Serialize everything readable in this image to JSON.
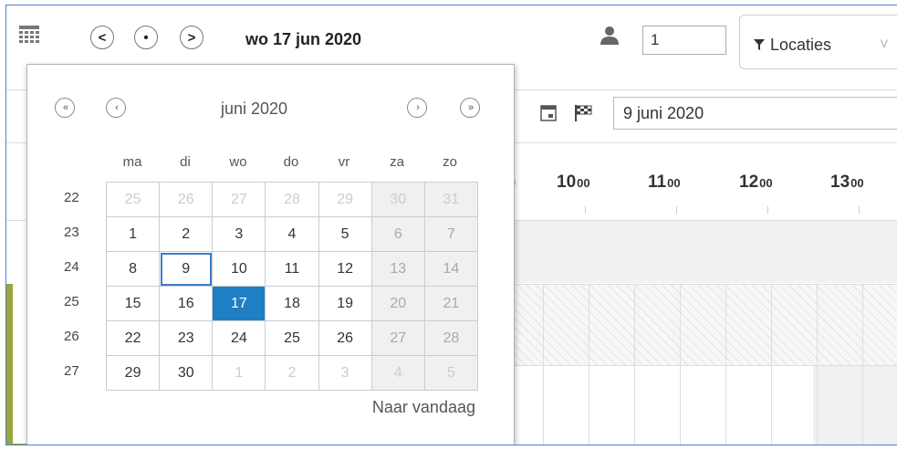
{
  "toolbar": {
    "prev_label": "<",
    "today_label": "•",
    "next_label": ">",
    "current_date": "wo 17 jun 2020",
    "persons_value": "1",
    "locations_label": "Locaties",
    "locations_chevron": "v"
  },
  "filters": {
    "end_date": "9 juni 2020"
  },
  "timeline": {
    "hours": [
      {
        "h": "10",
        "m": "00"
      },
      {
        "h": "11",
        "m": "00"
      },
      {
        "h": "12",
        "m": "00"
      },
      {
        "h": "13",
        "m": "00"
      }
    ],
    "partial_hour": ")"
  },
  "calendar": {
    "month_label": "juni 2020",
    "prev_year": "«",
    "prev_month": "‹",
    "next_month": "›",
    "next_year": "»",
    "weekdays": [
      "ma",
      "di",
      "wo",
      "do",
      "vr",
      "za",
      "zo"
    ],
    "weeks": [
      {
        "week": "22",
        "days": [
          {
            "d": "25",
            "other": true
          },
          {
            "d": "26",
            "other": true
          },
          {
            "d": "27",
            "other": true
          },
          {
            "d": "28",
            "other": true
          },
          {
            "d": "29",
            "other": true
          },
          {
            "d": "30",
            "other": true
          },
          {
            "d": "31",
            "other": true
          }
        ]
      },
      {
        "week": "23",
        "days": [
          {
            "d": "1"
          },
          {
            "d": "2"
          },
          {
            "d": "3"
          },
          {
            "d": "4"
          },
          {
            "d": "5"
          },
          {
            "d": "6"
          },
          {
            "d": "7"
          }
        ]
      },
      {
        "week": "24",
        "days": [
          {
            "d": "8"
          },
          {
            "d": "9",
            "chosen": true
          },
          {
            "d": "10"
          },
          {
            "d": "11"
          },
          {
            "d": "12"
          },
          {
            "d": "13"
          },
          {
            "d": "14"
          }
        ]
      },
      {
        "week": "25",
        "days": [
          {
            "d": "15"
          },
          {
            "d": "16"
          },
          {
            "d": "17",
            "selected": true
          },
          {
            "d": "18"
          },
          {
            "d": "19"
          },
          {
            "d": "20"
          },
          {
            "d": "21"
          }
        ]
      },
      {
        "week": "26",
        "days": [
          {
            "d": "22"
          },
          {
            "d": "23"
          },
          {
            "d": "24"
          },
          {
            "d": "25"
          },
          {
            "d": "26"
          },
          {
            "d": "27"
          },
          {
            "d": "28"
          }
        ]
      },
      {
        "week": "27",
        "days": [
          {
            "d": "29"
          },
          {
            "d": "30"
          },
          {
            "d": "1",
            "other": true
          },
          {
            "d": "2",
            "other": true
          },
          {
            "d": "3",
            "other": true
          },
          {
            "d": "4",
            "other": true
          },
          {
            "d": "5",
            "other": true
          }
        ]
      }
    ],
    "today_link": "Naar vandaag"
  },
  "colors": {
    "selected_day": "#1f7fc4",
    "accent_border": "#4a7fd6",
    "resource_bar": "#9aa53a"
  }
}
